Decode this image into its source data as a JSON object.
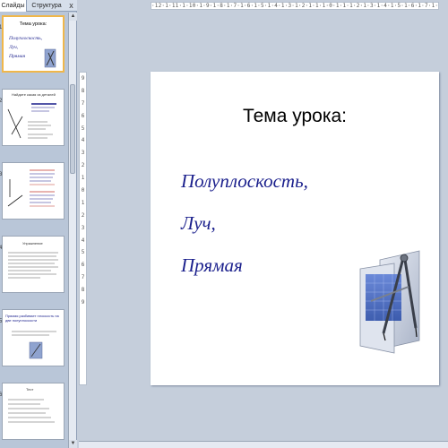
{
  "panel": {
    "tabs": [
      {
        "label": "Слайды"
      },
      {
        "label": "Структура"
      }
    ],
    "close_glyph": "x"
  },
  "ruler": {
    "horizontal": "·12·1·11·1·10·1·9·1·8·1·7·1·6·1·5·1·4·1·3·1·2·1·1·1·0·1·1·1·2·1·3·1·4·1·5·1·6·1·7·1·8·1·9·1·10·1·11·1·12·",
    "vertical": [
      "9",
      "8",
      "7",
      "6",
      "5",
      "4",
      "3",
      "2",
      "1",
      "0",
      "1",
      "2",
      "3",
      "4",
      "5",
      "6",
      "7",
      "8",
      "9"
    ]
  },
  "thumbnails": [
    {
      "num": "1",
      "title": "Тема урока:",
      "lines": [
        "Полуплоскость,",
        "Луч,",
        "Прямая"
      ]
    },
    {
      "num": "2",
      "heading": "Найдите какая из деталей"
    },
    {
      "num": "3",
      "heading": ""
    },
    {
      "num": "4",
      "heading": "Упражнение"
    },
    {
      "num": "5",
      "heading": "Прямая разбивает плоскость на две полуплоскости"
    },
    {
      "num": "6",
      "heading": "Тест"
    }
  ],
  "slide": {
    "title": "Тема урока:",
    "lines": [
      "Полуплоскость,",
      "Луч,",
      "Прямая"
    ]
  },
  "colors": {
    "accent_blue": "#1a1f8c",
    "selection": "#f0b74a",
    "panel_bg": "#b9c6d8"
  }
}
